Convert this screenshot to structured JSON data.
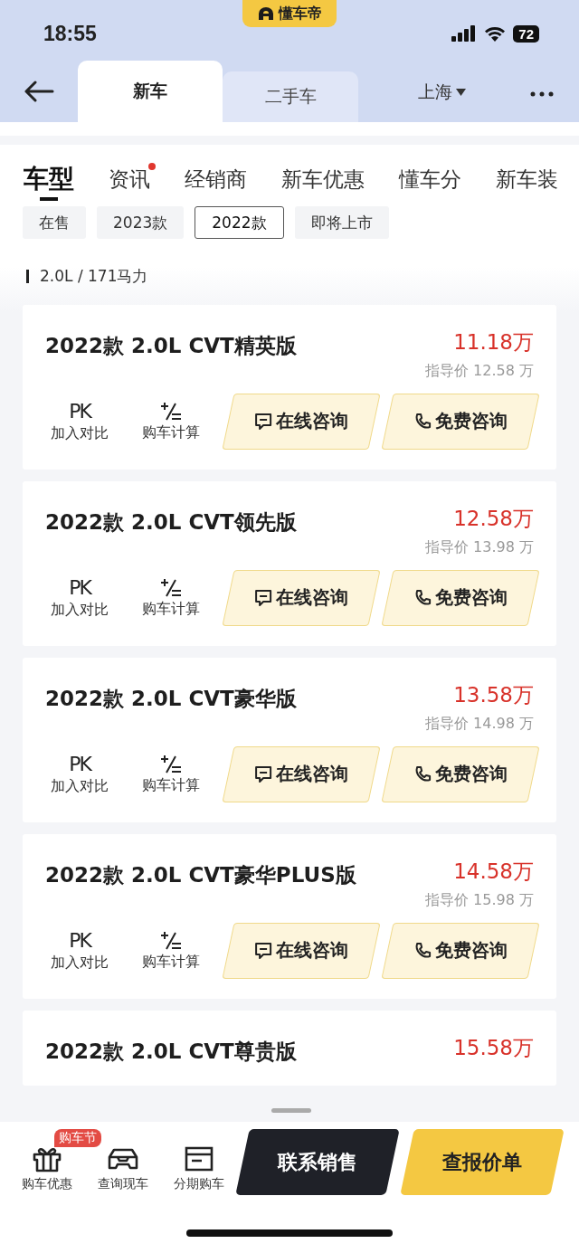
{
  "status_bar": {
    "time": "18:55",
    "app_badge": "懂车帝",
    "battery": "72"
  },
  "header": {
    "tabs": [
      {
        "label": "新车",
        "selected": true
      },
      {
        "label": "二手车",
        "selected": false
      }
    ],
    "city": "上海"
  },
  "category_tabs": [
    {
      "label": "车型",
      "selected": true,
      "dot": false
    },
    {
      "label": "资讯",
      "selected": false,
      "dot": true
    },
    {
      "label": "经销商",
      "selected": false,
      "dot": false
    },
    {
      "label": "新车优惠",
      "selected": false,
      "dot": false
    },
    {
      "label": "懂车分",
      "selected": false,
      "dot": false
    },
    {
      "label": "新车装",
      "selected": false,
      "dot": false
    }
  ],
  "filters": [
    {
      "label": "在售",
      "selected": false
    },
    {
      "label": "2023款",
      "selected": false
    },
    {
      "label": "2022款",
      "selected": true
    },
    {
      "label": "即将上市",
      "selected": false
    }
  ],
  "spec_group": "2.0L / 171马力",
  "cards": [
    {
      "title": "2022款 2.0L CVT精英版",
      "price": "11.18万",
      "guide_price": "指导价 12.58 万",
      "compare_icon": "PK",
      "compare": "加入对比",
      "calc": "购车计算",
      "chat": "在线咨询",
      "call": "免费咨询"
    },
    {
      "title": "2022款 2.0L CVT领先版",
      "price": "12.58万",
      "guide_price": "指导价 13.98 万",
      "compare_icon": "PK",
      "compare": "加入对比",
      "calc": "购车计算",
      "chat": "在线咨询",
      "call": "免费咨询"
    },
    {
      "title": "2022款 2.0L CVT豪华版",
      "price": "13.58万",
      "guide_price": "指导价 14.98 万",
      "compare_icon": "PK",
      "compare": "加入对比",
      "calc": "购车计算",
      "chat": "在线咨询",
      "call": "免费咨询"
    },
    {
      "title": "2022款 2.0L CVT豪华PLUS版",
      "price": "14.58万",
      "guide_price": "指导价 15.98 万",
      "compare_icon": "PK",
      "compare": "加入对比",
      "calc": "购车计算",
      "chat": "在线咨询",
      "call": "免费咨询"
    },
    {
      "title": "2022款 2.0L CVT尊贵版",
      "price": "15.58万"
    }
  ],
  "bottom_bar": {
    "items": [
      {
        "kind": "gift",
        "label": "购车优惠",
        "badge": "购车节"
      },
      {
        "kind": "car",
        "label": "查询现车"
      },
      {
        "kind": "card",
        "label": "分期购车"
      }
    ],
    "contact_button": "联系销售",
    "quote_button": "查报价单"
  }
}
